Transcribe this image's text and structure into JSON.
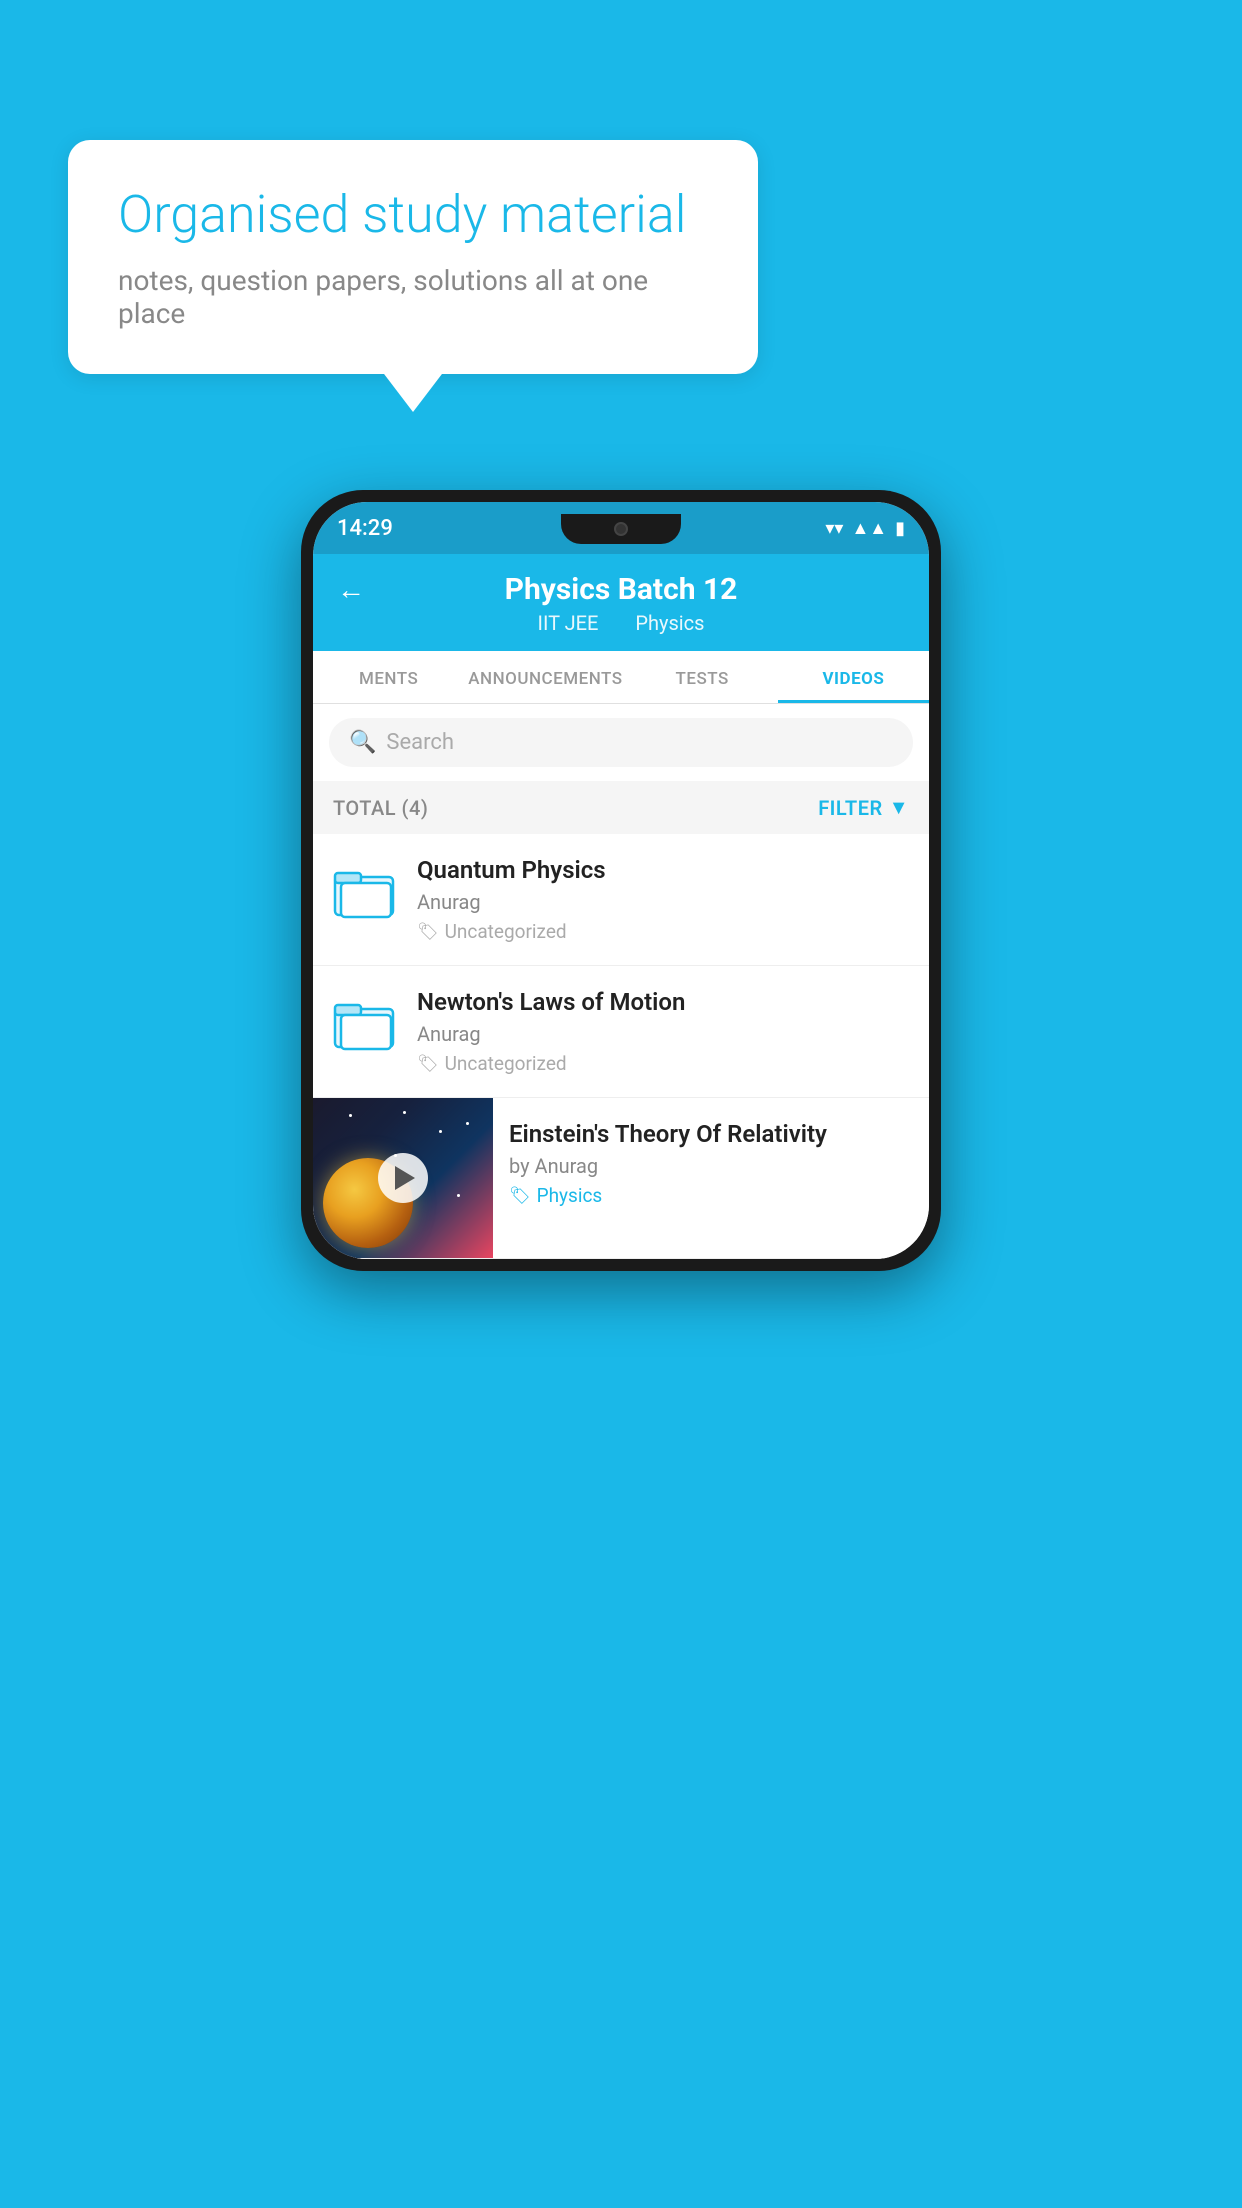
{
  "background": "#1ab8e8",
  "speech_bubble": {
    "title": "Organised study material",
    "subtitle": "notes, question papers, solutions all at one place"
  },
  "status_bar": {
    "time": "14:29",
    "icons": [
      "wifi",
      "signal",
      "battery"
    ]
  },
  "app_header": {
    "title": "Physics Batch 12",
    "subtitle_parts": [
      "IIT JEE",
      "Physics"
    ]
  },
  "tabs": [
    {
      "label": "MENTS",
      "active": false
    },
    {
      "label": "ANNOUNCEMENTS",
      "active": false
    },
    {
      "label": "TESTS",
      "active": false
    },
    {
      "label": "VIDEOS",
      "active": true
    }
  ],
  "search": {
    "placeholder": "Search"
  },
  "filter_bar": {
    "total": "TOTAL (4)",
    "filter_label": "FILTER"
  },
  "videos": [
    {
      "title": "Quantum Physics",
      "author": "Anurag",
      "tag": "Uncategorized",
      "type": "folder"
    },
    {
      "title": "Newton's Laws of Motion",
      "author": "Anurag",
      "tag": "Uncategorized",
      "type": "folder"
    },
    {
      "title": "Einstein's Theory Of Relativity",
      "author": "by Anurag",
      "tag": "Physics",
      "type": "video"
    }
  ]
}
